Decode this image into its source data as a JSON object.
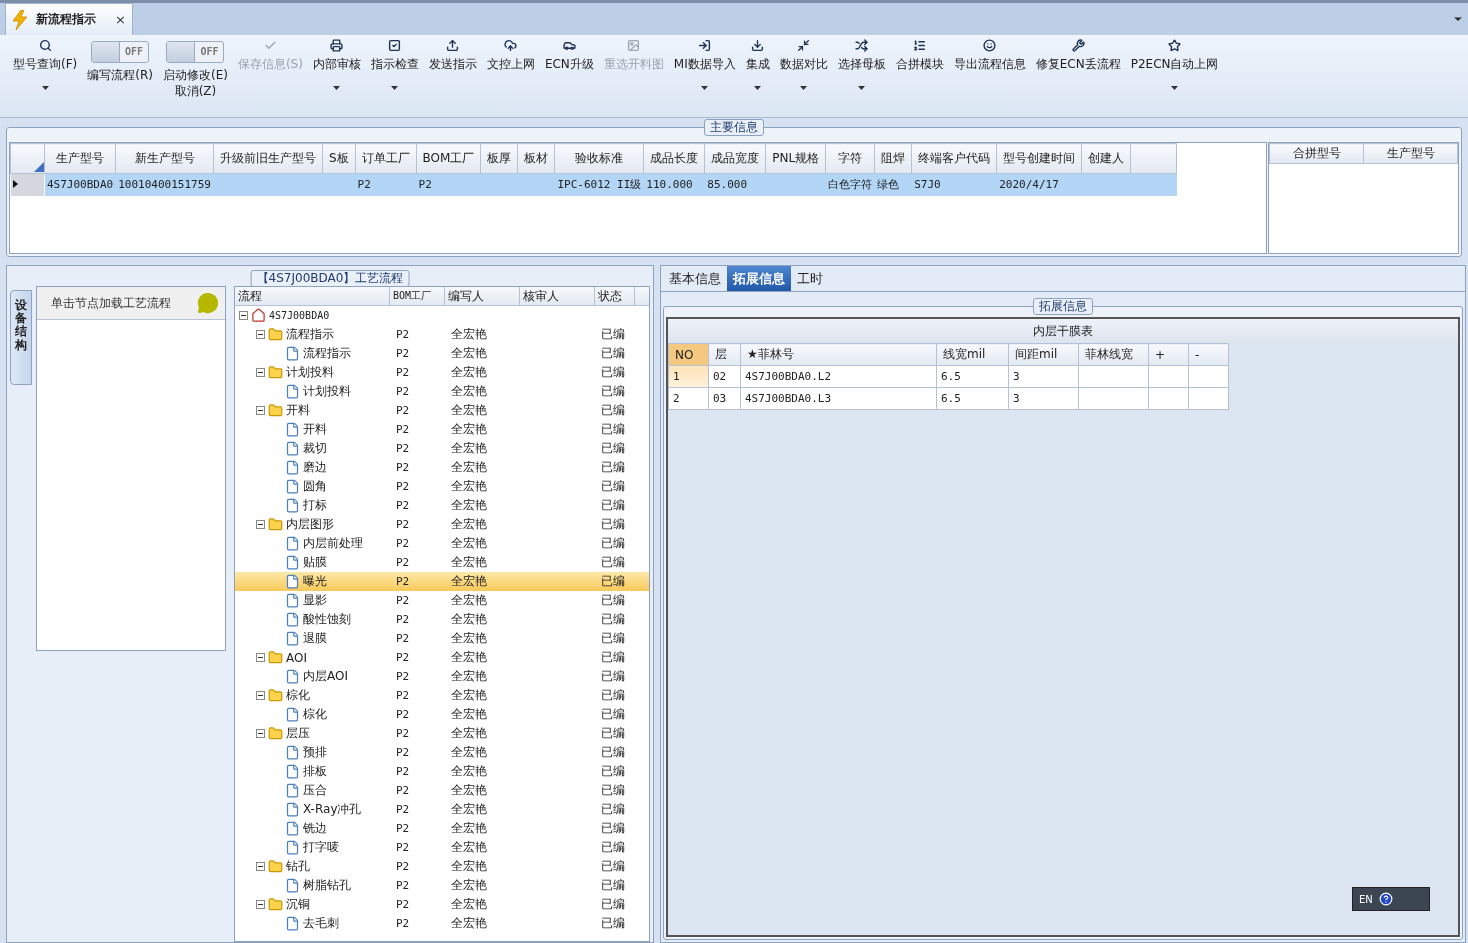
{
  "document_tab": {
    "title": "新流程指示",
    "close": "×"
  },
  "toolbar": [
    {
      "kind": "button",
      "label": "型号查询(F)",
      "dropdown": true,
      "disabled": false
    },
    {
      "kind": "toggle",
      "label": "编写流程(R)",
      "state_text": "OFF",
      "on": false
    },
    {
      "kind": "toggle",
      "label": "启动修改(E)\n取消(Z)",
      "state_text": "OFF",
      "on": false
    },
    {
      "kind": "button",
      "label": "保存信息(S)",
      "dropdown": false,
      "disabled": true
    },
    {
      "kind": "button",
      "label": "内部审核",
      "dropdown": true,
      "disabled": false
    },
    {
      "kind": "button",
      "label": "指示检查",
      "dropdown": true,
      "disabled": false
    },
    {
      "kind": "button",
      "label": "发送指示",
      "dropdown": false,
      "disabled": false
    },
    {
      "kind": "button",
      "label": "文控上网",
      "dropdown": false,
      "disabled": false
    },
    {
      "kind": "button",
      "label": "ECN升级",
      "dropdown": false,
      "disabled": false
    },
    {
      "kind": "button",
      "label": "重选开料图",
      "dropdown": false,
      "disabled": true
    },
    {
      "kind": "button",
      "label": "MI数据导入",
      "dropdown": true,
      "disabled": false
    },
    {
      "kind": "button",
      "label": "集成",
      "dropdown": true,
      "disabled": false
    },
    {
      "kind": "button",
      "label": "数据对比",
      "dropdown": true,
      "disabled": false
    },
    {
      "kind": "button",
      "label": "选择母板",
      "dropdown": true,
      "disabled": false
    },
    {
      "kind": "button",
      "label": "合拼模块",
      "dropdown": false,
      "disabled": false
    },
    {
      "kind": "button",
      "label": "导出流程信息",
      "dropdown": false,
      "disabled": false
    },
    {
      "kind": "button",
      "label": "修复ECN丢流程",
      "dropdown": false,
      "disabled": false
    },
    {
      "kind": "button",
      "label": "P2ECN自动上网",
      "dropdown": true,
      "disabled": false
    }
  ],
  "main_info": {
    "title": "主要信息",
    "columns": [
      "生产型号",
      "新生产型号",
      "升级前旧生产型号",
      "S板",
      "订单工厂",
      "BOM工厂",
      "板厚",
      "板材",
      "验收标准",
      "成品长度",
      "成品宽度",
      "PNL规格",
      "字符",
      "阻焊",
      "终端客户代码",
      "型号创建时间",
      "创建人"
    ],
    "rows": [
      {
        "selected": true,
        "cells": [
          "4S7J00BDA0",
          "10010400151759",
          "",
          "",
          "P2",
          "P2",
          "",
          "",
          "IPC-6012 II级",
          "110.000",
          "85.000",
          "",
          "白色字符",
          "绿色",
          "S7J0",
          "2020/4/17",
          ""
        ]
      }
    ],
    "side_columns": [
      "合拼型号",
      "生产型号"
    ]
  },
  "equipment_panel": {
    "side_tab": "设备结构",
    "hint": "单击节点加载工艺流程"
  },
  "process_tree": {
    "title": "【4S7J00BDA0】工艺流程",
    "columns": [
      "流程",
      "BOM工厂",
      "编写人",
      "核审人",
      "状态"
    ],
    "root": {
      "name": "4S7J00BDA0",
      "expanded": true,
      "children": [
        {
          "name": "流程指示",
          "expanded": true,
          "bom": "P2",
          "writer": "全宏艳",
          "status": "已编",
          "children": [
            {
              "name": "流程指示",
              "bom": "P2",
              "writer": "全宏艳",
              "status": "已编",
              "selected": false
            }
          ]
        },
        {
          "name": "计划投料",
          "expanded": true,
          "bom": "P2",
          "writer": "全宏艳",
          "status": "已编",
          "children": [
            {
              "name": "计划投料",
              "bom": "P2",
              "writer": "全宏艳",
              "status": "已编",
              "selected": false
            }
          ]
        },
        {
          "name": "开料",
          "expanded": true,
          "bom": "P2",
          "writer": "全宏艳",
          "status": "已编",
          "children": [
            {
              "name": "开料",
              "bom": "P2",
              "writer": "全宏艳",
              "status": "已编",
              "selected": false
            },
            {
              "name": "裁切",
              "bom": "P2",
              "writer": "全宏艳",
              "status": "已编",
              "selected": false
            },
            {
              "name": "磨边",
              "bom": "P2",
              "writer": "全宏艳",
              "status": "已编",
              "selected": false
            },
            {
              "name": "圆角",
              "bom": "P2",
              "writer": "全宏艳",
              "status": "已编",
              "selected": false
            },
            {
              "name": "打标",
              "bom": "P2",
              "writer": "全宏艳",
              "status": "已编",
              "selected": false
            }
          ]
        },
        {
          "name": "内层图形",
          "expanded": true,
          "bom": "P2",
          "writer": "全宏艳",
          "status": "已编",
          "children": [
            {
              "name": "内层前处理",
              "bom": "P2",
              "writer": "全宏艳",
              "status": "已编",
              "selected": false
            },
            {
              "name": "贴膜",
              "bom": "P2",
              "writer": "全宏艳",
              "status": "已编",
              "selected": false
            },
            {
              "name": "曝光",
              "bom": "P2",
              "writer": "全宏艳",
              "status": "已编",
              "selected": true
            },
            {
              "name": "显影",
              "bom": "P2",
              "writer": "全宏艳",
              "status": "已编",
              "selected": false
            },
            {
              "name": "酸性蚀刻",
              "bom": "P2",
              "writer": "全宏艳",
              "status": "已编",
              "selected": false
            },
            {
              "name": "退膜",
              "bom": "P2",
              "writer": "全宏艳",
              "status": "已编",
              "selected": false
            }
          ]
        },
        {
          "name": "AOI",
          "expanded": true,
          "bom": "P2",
          "writer": "全宏艳",
          "status": "已编",
          "children": [
            {
              "name": "内层AOI",
              "bom": "P2",
              "writer": "全宏艳",
              "status": "已编",
              "selected": false
            }
          ]
        },
        {
          "name": "棕化",
          "expanded": true,
          "bom": "P2",
          "writer": "全宏艳",
          "status": "已编",
          "children": [
            {
              "name": "棕化",
              "bom": "P2",
              "writer": "全宏艳",
              "status": "已编",
              "selected": false
            }
          ]
        },
        {
          "name": "层压",
          "expanded": true,
          "bom": "P2",
          "writer": "全宏艳",
          "status": "已编",
          "children": [
            {
              "name": "预排",
              "bom": "P2",
              "writer": "全宏艳",
              "status": "已编",
              "selected": false
            },
            {
              "name": "排板",
              "bom": "P2",
              "writer": "全宏艳",
              "status": "已编",
              "selected": false
            },
            {
              "name": "压合",
              "bom": "P2",
              "writer": "全宏艳",
              "status": "已编",
              "selected": false
            },
            {
              "name": "X-Ray冲孔",
              "bom": "P2",
              "writer": "全宏艳",
              "status": "已编",
              "selected": false
            },
            {
              "name": "铣边",
              "bom": "P2",
              "writer": "全宏艳",
              "status": "已编",
              "selected": false
            },
            {
              "name": "打字唛",
              "bom": "P2",
              "writer": "全宏艳",
              "status": "已编",
              "selected": false
            }
          ]
        },
        {
          "name": "钻孔",
          "expanded": true,
          "bom": "P2",
          "writer": "全宏艳",
          "status": "已编",
          "children": [
            {
              "name": "树脂钻孔",
              "bom": "P2",
              "writer": "全宏艳",
              "status": "已编",
              "selected": false
            }
          ]
        },
        {
          "name": "沉铜",
          "expanded": true,
          "bom": "P2",
          "writer": "全宏艳",
          "status": "已编",
          "children": [
            {
              "name": "去毛刺",
              "bom": "P2",
              "writer": "全宏艳",
              "status": "已编",
              "selected": false
            }
          ]
        }
      ]
    }
  },
  "detail_tabs": [
    {
      "label": "基本信息",
      "selected": false
    },
    {
      "label": "拓展信息",
      "selected": true
    },
    {
      "label": "工时",
      "selected": false
    }
  ],
  "extended_info": {
    "title": "拓展信息",
    "table_title": "内层干膜表",
    "columns": [
      "NO",
      "层",
      "★菲林号",
      "线宽mil",
      "间距mil",
      "菲林线宽",
      "+",
      "-"
    ],
    "rows": [
      {
        "selected": true,
        "cells": [
          "1",
          "02",
          "4S7J00BDA0.L2",
          "6.5",
          "3",
          "",
          "",
          ""
        ]
      },
      {
        "selected": false,
        "cells": [
          "2",
          "03",
          "4S7J00BDA0.L3",
          "6.5",
          "3",
          "",
          "",
          ""
        ]
      }
    ]
  },
  "language_bar": {
    "label": "EN"
  }
}
